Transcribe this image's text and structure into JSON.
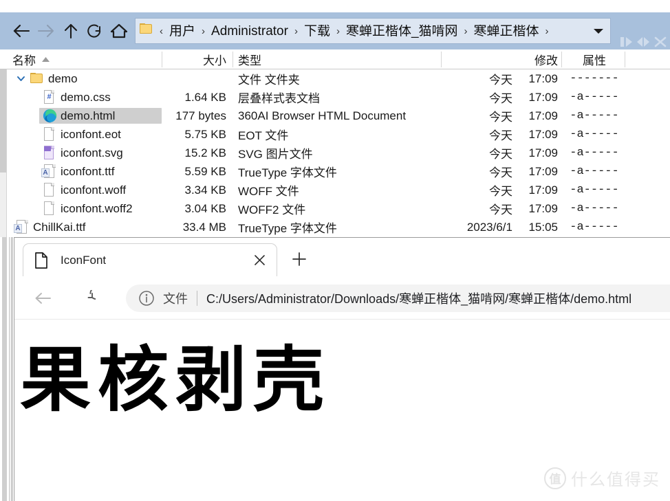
{
  "file_manager": {
    "nav": [
      {
        "name": "back-button",
        "icon": "arrow-left-icon",
        "enabled": true
      },
      {
        "name": "forward-button",
        "icon": "arrow-right-icon",
        "enabled": false
      },
      {
        "name": "up-button",
        "icon": "arrow-up-icon",
        "enabled": true
      },
      {
        "name": "refresh-button",
        "icon": "refresh-icon",
        "enabled": true
      },
      {
        "name": "home-button",
        "icon": "home-icon",
        "enabled": true
      }
    ],
    "breadcrumb": {
      "lead_separator": "‹",
      "items": [
        "用户",
        "Administrator",
        "下载",
        "寒蝉正楷体_猫啃网",
        "寒蝉正楷体"
      ],
      "separator": "›",
      "dropdown_icon": "chevron-down-icon"
    },
    "right_glyphs": [
      "pause-play-icon",
      "prev-next-icon",
      "close-icon"
    ],
    "columns": [
      {
        "key": "name",
        "label": "名称",
        "sorted": true,
        "sort_icon": "sort-asc-icon"
      },
      {
        "key": "size",
        "label": "大小"
      },
      {
        "key": "type",
        "label": "类型"
      },
      {
        "key": "modified",
        "label": "修改"
      },
      {
        "key": "attributes",
        "label": "属性"
      }
    ],
    "rows": [
      {
        "name": "demo",
        "icon": "folder-icon",
        "size": "",
        "type": "文件 文件夹",
        "date": "今天",
        "time": "17:09",
        "attr": "-------",
        "indent": 0,
        "expanded": true,
        "selected": false,
        "highlight": true
      },
      {
        "name": "demo.css",
        "icon": "css-file-icon",
        "size": "1.64 KB",
        "type": "层叠样式表文档",
        "date": "今天",
        "time": "17:09",
        "attr": "-a-----",
        "indent": 1,
        "selected": false,
        "highlight": false
      },
      {
        "name": "demo.html",
        "icon": "edge-file-icon",
        "size": "177 bytes",
        "type": "360AI Browser HTML Document",
        "date": "今天",
        "time": "17:09",
        "attr": "-a-----",
        "indent": 1,
        "selected": true,
        "highlight": false
      },
      {
        "name": "iconfont.eot",
        "icon": "blank-file-icon",
        "size": "5.75 KB",
        "type": "EOT 文件",
        "date": "今天",
        "time": "17:09",
        "attr": "-a-----",
        "indent": 1,
        "selected": false,
        "highlight": false
      },
      {
        "name": "iconfont.svg",
        "icon": "svg-file-icon",
        "size": "15.2 KB",
        "type": "SVG 图片文件",
        "date": "今天",
        "time": "17:09",
        "attr": "-a-----",
        "indent": 1,
        "selected": false,
        "highlight": false
      },
      {
        "name": "iconfont.ttf",
        "icon": "font-file-icon",
        "size": "5.59 KB",
        "type": "TrueType 字体文件",
        "date": "今天",
        "time": "17:09",
        "attr": "-a-----",
        "indent": 1,
        "selected": false,
        "highlight": false
      },
      {
        "name": "iconfont.woff",
        "icon": "blank-file-icon",
        "size": "3.34 KB",
        "type": "WOFF 文件",
        "date": "今天",
        "time": "17:09",
        "attr": "-a-----",
        "indent": 1,
        "selected": false,
        "highlight": false
      },
      {
        "name": "iconfont.woff2",
        "icon": "blank-file-icon",
        "size": "3.04 KB",
        "type": "WOFF2 文件",
        "date": "今天",
        "time": "17:09",
        "attr": "-a-----",
        "indent": 1,
        "selected": false,
        "highlight": false
      },
      {
        "name": "ChillKai.ttf",
        "icon": "font-file-icon",
        "size": "33.4 MB",
        "type": "TrueType 字体文件",
        "date": "2023/6/1",
        "time": "15:05",
        "attr": "-a-----",
        "indent": 0,
        "selected": false,
        "highlight": false
      }
    ]
  },
  "browser": {
    "tab": {
      "title": "IconFont",
      "icon": "page-file-icon",
      "close_icon": "close-icon"
    },
    "new_tab_icon": "plus-icon",
    "toolbar": {
      "back_icon": "arrow-left-icon",
      "reload_icon": "reload-icon",
      "info_icon": "info-circle-icon",
      "scheme_label": "文件",
      "url": "C:/Users/Administrator/Downloads/寒蝉正楷体_猫啃网/寒蝉正楷体/demo.html"
    },
    "page": {
      "heading": "果核剥壳"
    },
    "watermark": {
      "logo": "值",
      "text": "什么值得买"
    }
  },
  "colors": {
    "toolbar_blue": "#a8c0dc",
    "path_field": "#dde6f2",
    "folder_blue_text": "#2b2bc8",
    "selection_grey": "#cfcfcf",
    "omnibox_grey": "#f3f3f3"
  }
}
